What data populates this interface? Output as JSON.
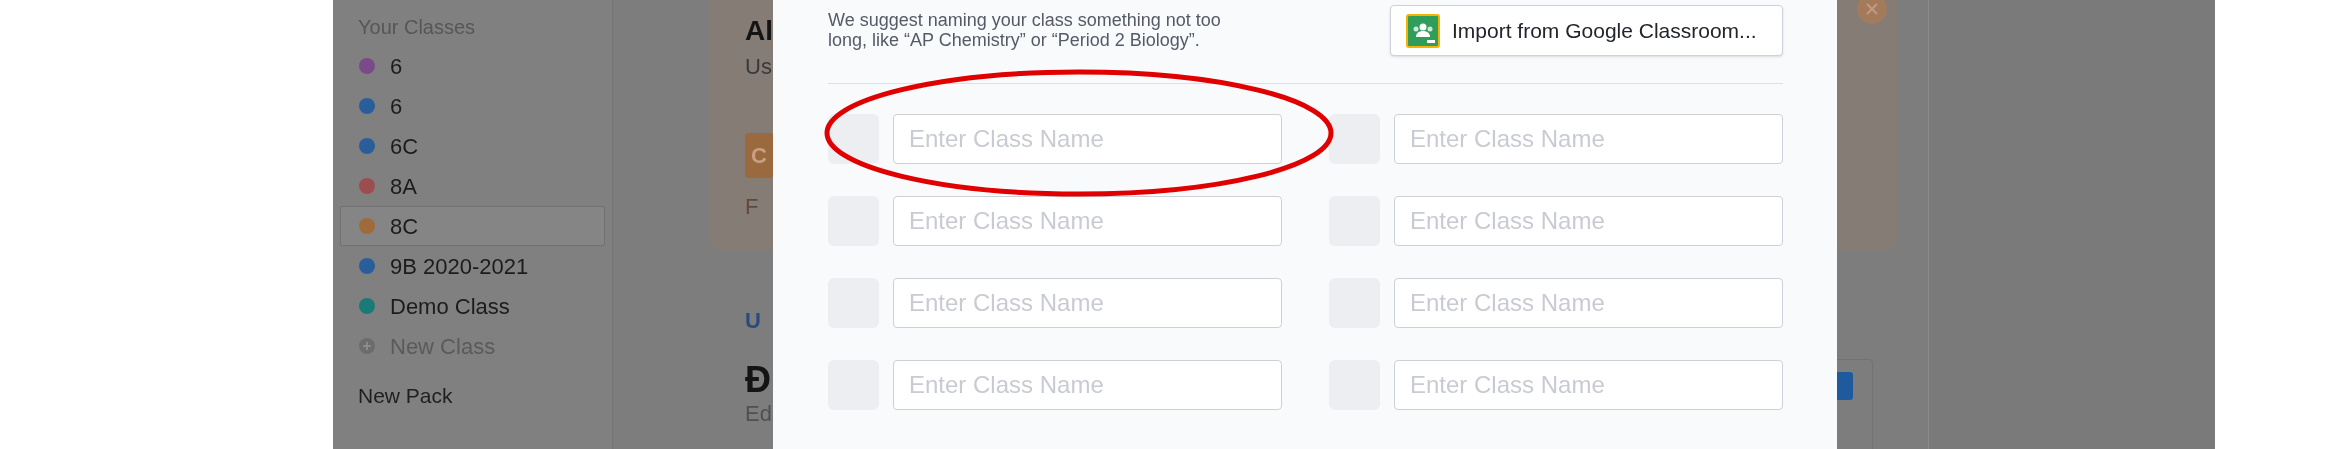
{
  "sidebar": {
    "heading": "Your Classes",
    "classes": [
      {
        "name": "6",
        "color": "#7a4a8a",
        "selected": false
      },
      {
        "name": "6",
        "color": "#2a5e9a",
        "selected": false
      },
      {
        "name": "6C",
        "color": "#2a5e9a",
        "selected": false
      },
      {
        "name": "8A",
        "color": "#9c4e4e",
        "selected": false
      },
      {
        "name": "8C",
        "color": "#a06a3a",
        "selected": true
      },
      {
        "name": "9B 2020-2021",
        "color": "#2a5e9a",
        "selected": false
      },
      {
        "name": "Demo Class",
        "color": "#1a7a78",
        "selected": false
      }
    ],
    "new_class": "New Class",
    "new_pack": "New Pack"
  },
  "background": {
    "card_title": "Al",
    "card_text": "Us",
    "card_button": "C",
    "card_note": "F",
    "section_link": "U",
    "section_title": "Đ",
    "section_text": "Ed"
  },
  "modal": {
    "hint_lines": [
      "We suggest naming your class something not too",
      "long, like “AP Chemistry” or “Period 2 Biology”."
    ],
    "import_button": "Import from Google Classroom...",
    "rows": [
      {
        "fields": [
          {
            "placeholder": "Enter Class Name"
          },
          {
            "placeholder": "Enter Class Name"
          }
        ]
      },
      {
        "fields": [
          {
            "placeholder": "Enter Class Name"
          },
          {
            "placeholder": "Enter Class Name"
          }
        ]
      },
      {
        "fields": [
          {
            "placeholder": "Enter Class Name"
          },
          {
            "placeholder": "Enter Class Name"
          }
        ]
      },
      {
        "fields": [
          {
            "placeholder": "Enter Class Name"
          },
          {
            "placeholder": "Enter Class Name"
          }
        ]
      }
    ]
  }
}
